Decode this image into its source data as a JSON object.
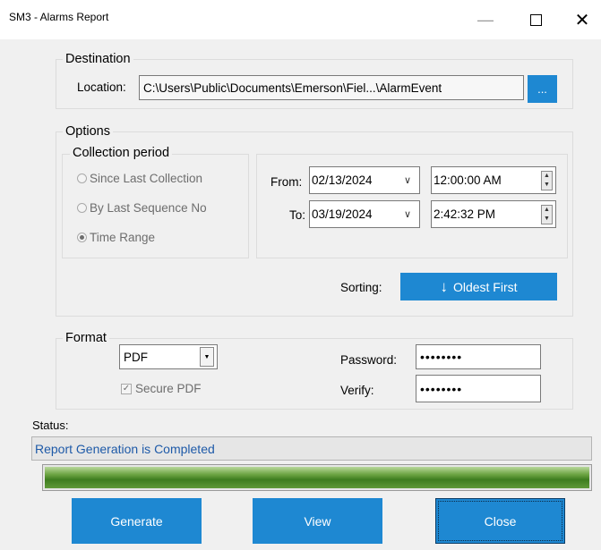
{
  "window": {
    "title": "SM3 - Alarms Report"
  },
  "destination": {
    "legend": "Destination",
    "location_label": "Location:",
    "location_value": "C:\\Users\\Public\\Documents\\Emerson\\Fiel...\\AlarmEvent",
    "browse_label": "..."
  },
  "options": {
    "legend": "Options",
    "collection_legend": "Collection period",
    "radios": [
      {
        "label": "Since Last Collection",
        "selected": false
      },
      {
        "label": "By Last Sequence No",
        "selected": false
      },
      {
        "label": "Time Range",
        "selected": true
      }
    ],
    "from_label": "From:",
    "from_date": "02/13/2024",
    "from_time": "12:00:00 AM",
    "to_label": "To:",
    "to_date": "03/19/2024",
    "to_time": "2:42:32 PM",
    "sorting_label": "Sorting:",
    "sorting_button": "Oldest First"
  },
  "format": {
    "legend": "Format",
    "type_value": "PDF",
    "secure_pdf_label": "Secure PDF",
    "secure_pdf_checked": true,
    "password_label": "Password:",
    "password_value": "••••••••",
    "verify_label": "Verify:",
    "verify_value": "••••••••"
  },
  "status": {
    "label": "Status:",
    "message": "Report Generation is Completed",
    "progress": 1.0
  },
  "buttons": {
    "generate": "Generate",
    "view": "View",
    "close": "Close"
  },
  "colors": {
    "accent_button": "#1e88d2",
    "status_text": "#1e5aa8",
    "progress_green": "#3e7d1f"
  }
}
